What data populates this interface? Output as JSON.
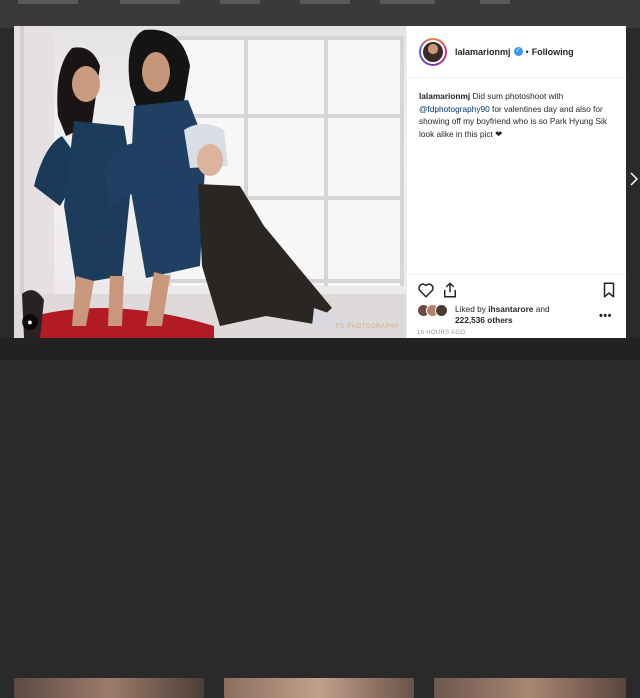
{
  "post": {
    "username": "lalamarionmj",
    "follow_status": "Following",
    "caption": {
      "username": "lalamarionmj",
      "text_1": "Did sum photoshoot with",
      "mention": "@fdphotography90",
      "text_2": "for valentines day and also for showing off my boyfriend who is so Park Hyung Sik look alike in this pict ❤"
    },
    "likes": {
      "prefix": "Liked by",
      "user": "ihsantarore",
      "and": "and",
      "count": "222,536 others"
    },
    "timestamp": "16 HOURS AGO",
    "more_label": "•••"
  },
  "icons": {
    "verified": "verified-badge-icon",
    "like": "heart-icon",
    "share": "share-icon",
    "save": "bookmark-icon",
    "user_tag": "user-tag-icon",
    "next": "chevron-right-icon"
  },
  "photo": {
    "watermark": "FD PHOTOGRAPHY"
  },
  "colors": {
    "accent_blue": "#3897f0",
    "mention_blue": "#003569",
    "text": "#262626",
    "muted": "#999999"
  }
}
